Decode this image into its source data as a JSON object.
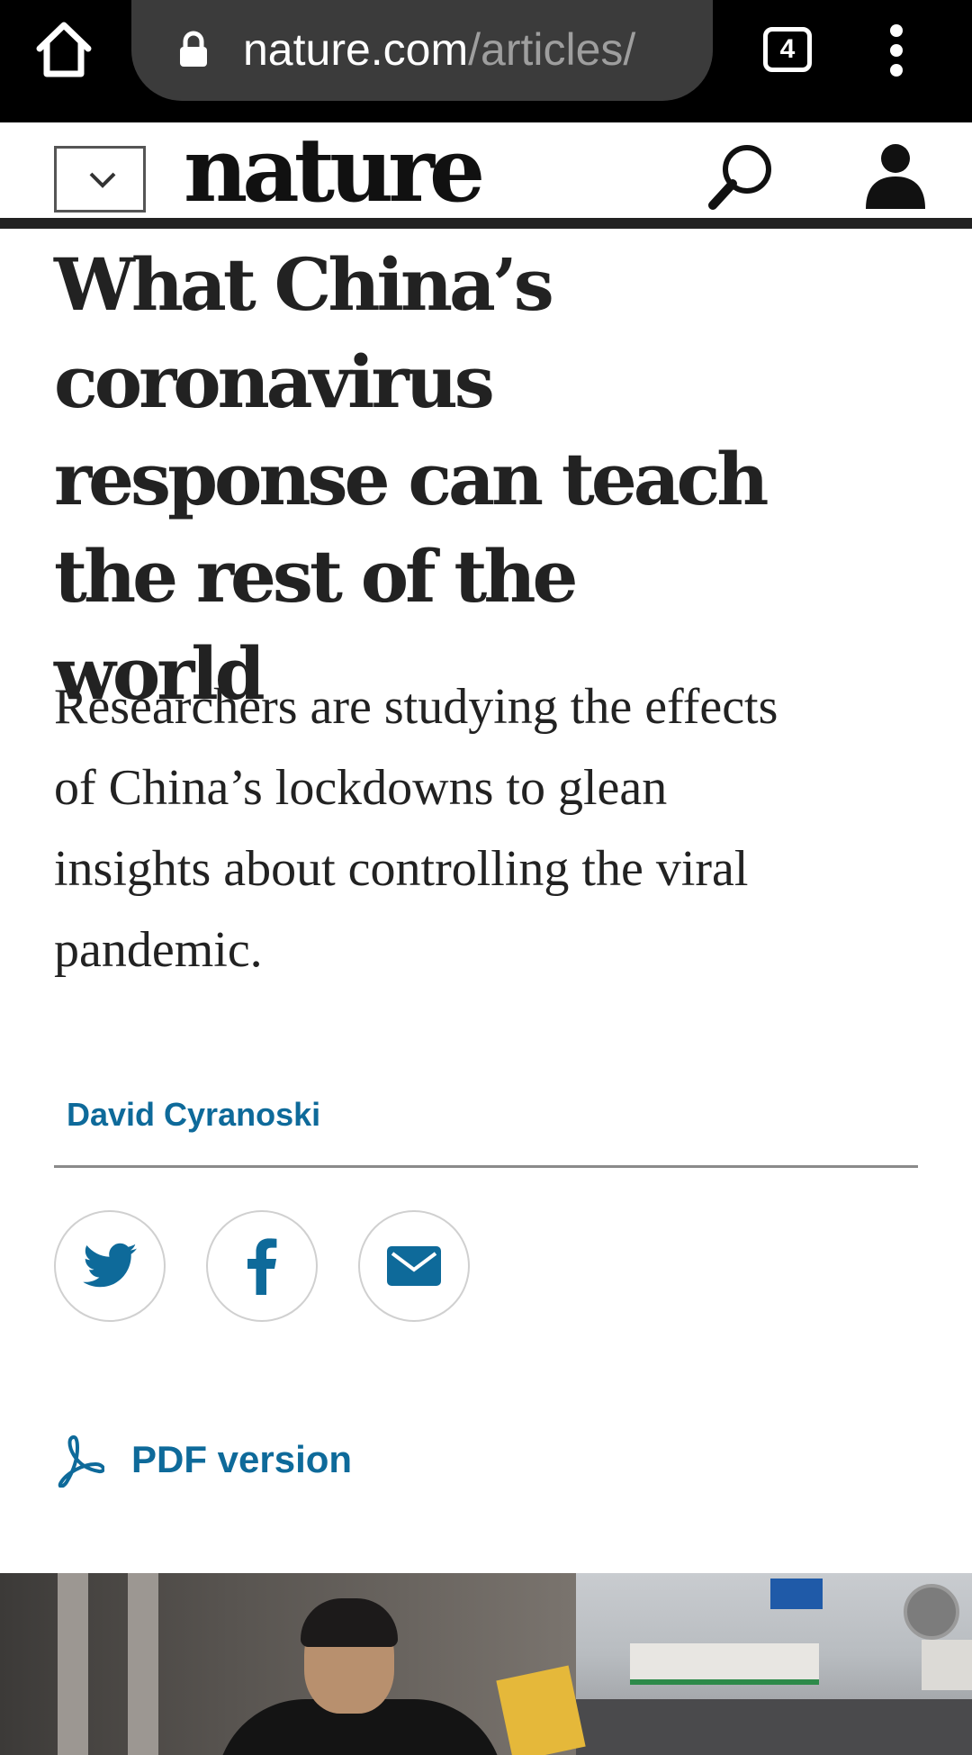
{
  "browser": {
    "url_host": "nature.com",
    "url_path": "/articles/",
    "tab_count": "4",
    "icons": [
      "home-icon",
      "lock-icon",
      "tabs-icon",
      "overflow-menu-icon"
    ]
  },
  "site": {
    "logo": "nature",
    "icons": [
      "chevron-down-icon",
      "search-icon",
      "account-icon"
    ]
  },
  "article": {
    "headline": "What China’s coronavirus response can teach the rest of the world",
    "standfirst": "Researchers are studying the effects of China’s lockdowns to glean insights about controlling the viral pandemic.",
    "author": "David Cyranoski",
    "share_icons": [
      "twitter-icon",
      "facebook-icon",
      "email-icon"
    ],
    "pdf_label": "PDF version"
  },
  "colors": {
    "link_blue": "#0e6a9a",
    "chrome_black": "#000000",
    "urlbar_gray": "#3b3b3b"
  }
}
